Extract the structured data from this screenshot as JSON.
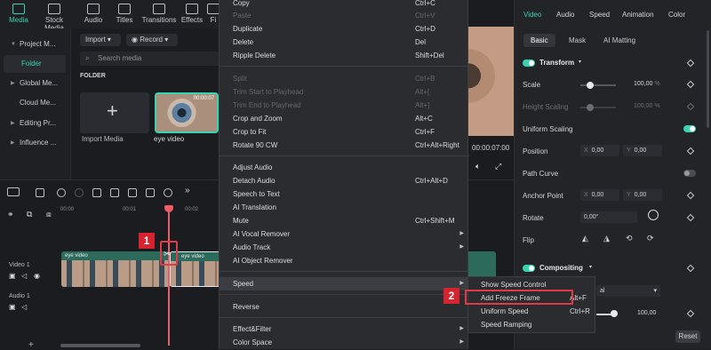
{
  "top_tabs": [
    {
      "label": "Media",
      "icon": "media-icon",
      "active": true
    },
    {
      "label": "Stock Media",
      "icon": "stock-media-icon",
      "active": false
    },
    {
      "label": "Audio",
      "icon": "audio-icon",
      "active": false
    },
    {
      "label": "Titles",
      "icon": "titles-icon",
      "active": false
    },
    {
      "label": "Transitions",
      "icon": "transitions-icon",
      "active": false
    },
    {
      "label": "Effects",
      "icon": "effects-icon",
      "active": false
    },
    {
      "label": "Fi",
      "icon": "filters-icon",
      "active": false
    }
  ],
  "sidebar": {
    "items": [
      {
        "label": "Project M...",
        "arrow": "▼"
      },
      {
        "label": "Folder",
        "arrow": ""
      },
      {
        "label": "Global Me...",
        "arrow": "▶"
      },
      {
        "label": "Cloud Me...",
        "arrow": ""
      },
      {
        "label": "Editing Pr...",
        "arrow": "▶"
      },
      {
        "label": "Influence ...",
        "arrow": "▶"
      }
    ]
  },
  "media": {
    "import_btn": "Import",
    "record_btn": "Record",
    "search_placeholder": "Search media",
    "folder_title": "FOLDER",
    "import_tile_label": "Import Media",
    "clip_label": "eye video",
    "clip_duration": "00:00:07"
  },
  "preview": {
    "timecode": "00:00:07:00"
  },
  "context_menu": {
    "items": [
      {
        "label": "Copy",
        "shortcut": "Ctrl+C",
        "disabled": false
      },
      {
        "label": "Paste",
        "shortcut": "Ctrl+V",
        "disabled": true
      },
      {
        "label": "Duplicate",
        "shortcut": "Ctrl+D",
        "disabled": false
      },
      {
        "label": "Delete",
        "shortcut": "Del",
        "disabled": false
      },
      {
        "label": "Ripple Delete",
        "shortcut": "Shift+Del",
        "disabled": false
      },
      {
        "label": "Split",
        "shortcut": "Ctrl+B",
        "disabled": true
      },
      {
        "label": "Trim Start to Playhead",
        "shortcut": "Alt+[",
        "disabled": true
      },
      {
        "label": "Trim End to Playhead",
        "shortcut": "Alt+]",
        "disabled": true
      },
      {
        "label": "Crop and Zoom",
        "shortcut": "Alt+C",
        "disabled": false
      },
      {
        "label": "Crop to Fit",
        "shortcut": "Ctrl+F",
        "disabled": false
      },
      {
        "label": "Rotate 90 CW",
        "shortcut": "Ctrl+Alt+Right",
        "disabled": false
      },
      {
        "label": "Adjust Audio",
        "shortcut": "",
        "disabled": false
      },
      {
        "label": "Detach Audio",
        "shortcut": "Ctrl+Alt+D",
        "disabled": false
      },
      {
        "label": "Speech to Text",
        "shortcut": "",
        "disabled": false
      },
      {
        "label": "AI Translation",
        "shortcut": "",
        "disabled": false
      },
      {
        "label": "Mute",
        "shortcut": "Ctrl+Shift+M",
        "disabled": false
      },
      {
        "label": "AI Vocal Remover",
        "shortcut": "",
        "disabled": false
      },
      {
        "label": "Audio Track",
        "shortcut": "",
        "disabled": false
      },
      {
        "label": "AI Object Remover",
        "shortcut": "",
        "disabled": false
      },
      {
        "label": "Speed",
        "shortcut": "",
        "disabled": false
      },
      {
        "label": "Reverse",
        "shortcut": "",
        "disabled": false
      },
      {
        "label": "Effect&Filter",
        "shortcut": "",
        "disabled": false
      },
      {
        "label": "Color Space",
        "shortcut": "",
        "disabled": false
      }
    ]
  },
  "speed_submenu": {
    "items": [
      {
        "label": "Show Speed Control",
        "shortcut": ""
      },
      {
        "label": "Add Freeze Frame",
        "shortcut": "Alt+F"
      },
      {
        "label": "Uniform Speed",
        "shortcut": "Ctrl+R"
      },
      {
        "label": "Speed Ramping",
        "shortcut": ""
      }
    ]
  },
  "properties": {
    "tabs": [
      "Video",
      "Audio",
      "Speed",
      "Animation",
      "Color"
    ],
    "subtabs": [
      "Basic",
      "Mask",
      "AI Matting"
    ],
    "transform_title": "Transform",
    "scale_label": "Scale",
    "scale_value": "100,00",
    "scale_unit": "%",
    "height_scaling_label": "Height Scaling",
    "height_scaling_value": "100,00",
    "height_scaling_unit": "%",
    "uniform_scaling_label": "Uniform Scaling",
    "position_label": "Position",
    "position_x": "0,00",
    "position_y": "0,00",
    "path_curve_label": "Path Curve",
    "anchor_label": "Anchor Point",
    "anchor_x": "0,00",
    "anchor_y": "0,00",
    "rotate_label": "Rotate",
    "rotate_value": "0,00°",
    "flip_label": "Flip",
    "compositing_title": "Compositing",
    "blend_value_partial": "al",
    "opacity_value": "100,00",
    "reset_label": "Reset",
    "axis_x": "X",
    "axis_y": "Y"
  },
  "timeline": {
    "ruler_ticks": [
      "00:00",
      "00:01",
      "00:02"
    ],
    "video_track_label": "Video 1",
    "audio_track_label": "Audio 1",
    "clip1_title": "eye video",
    "clip2_title": "eye video"
  },
  "annotations": {
    "badge1": "1",
    "badge2": "2"
  },
  "colors": {
    "accent": "#38d3b1",
    "highlight_box": "#e03b46",
    "playhead": "#f05b66"
  }
}
